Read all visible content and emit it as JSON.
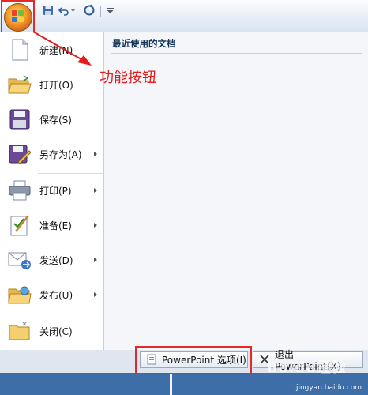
{
  "quick_access": {
    "office_button": "Office Button",
    "save": "save-icon",
    "undo": "undo-icon",
    "redo": "redo-icon",
    "customize": "customize-icon"
  },
  "menu": {
    "items": [
      {
        "label": "新建(N)",
        "icon": "new-document-icon",
        "has_submenu": false
      },
      {
        "label": "打开(O)",
        "icon": "open-folder-icon",
        "has_submenu": false
      },
      {
        "label": "保存(S)",
        "icon": "floppy-disk-icon",
        "has_submenu": false
      },
      {
        "label": "另存为(A)",
        "icon": "save-as-icon",
        "has_submenu": true
      },
      {
        "label": "打印(P)",
        "icon": "printer-icon",
        "has_submenu": true
      },
      {
        "label": "准备(E)",
        "icon": "prepare-icon",
        "has_submenu": true
      },
      {
        "label": "发送(D)",
        "icon": "send-icon",
        "has_submenu": true
      },
      {
        "label": "发布(U)",
        "icon": "publish-icon",
        "has_submenu": true
      },
      {
        "label": "关闭(C)",
        "icon": "close-folder-icon",
        "has_submenu": false
      }
    ]
  },
  "recent": {
    "title": "最近使用的文档"
  },
  "annotation": {
    "text": "功能按钮"
  },
  "bottom_buttons": {
    "options": "PowerPoint 选项(I)",
    "exit": "退出 PowerPoint(X)"
  },
  "watermark": {
    "brand": "Baidu经验",
    "url": "jingyan.baidu.com"
  },
  "colors": {
    "highlight": "#e22a2a",
    "annotation": "#e21b1b",
    "office_orange": "#f6a02b"
  }
}
